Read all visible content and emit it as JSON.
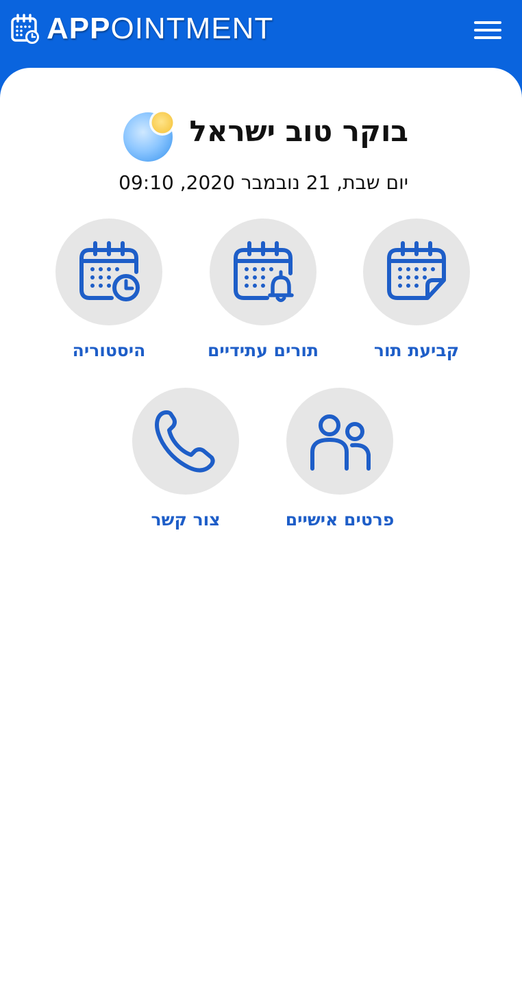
{
  "app": {
    "logo_bold": "APP",
    "logo_light": "OINTMENT",
    "logo_icon": "calendar-clock-icon",
    "menu_icon": "hamburger-menu-icon"
  },
  "greeting": {
    "title": "בוקר טוב ישראל",
    "icon": "sun-and-moon-icon",
    "date_time": "יום שבת, 21 נובמבר 2020, 09:10"
  },
  "tiles": [
    {
      "label": "קביעת תור",
      "icon": "calendar-edit-icon"
    },
    {
      "label": "תורים עתידיים",
      "icon": "calendar-bell-icon"
    },
    {
      "label": "היסטוריה",
      "icon": "calendar-clock-icon"
    },
    {
      "label": "פרטים אישיים",
      "icon": "people-icon"
    },
    {
      "label": "צור קשר",
      "icon": "phone-icon"
    }
  ],
  "colors": {
    "brand_blue": "#0a64de",
    "icon_blue": "#1e5ec8",
    "tile_bg": "#e6e6e6"
  }
}
